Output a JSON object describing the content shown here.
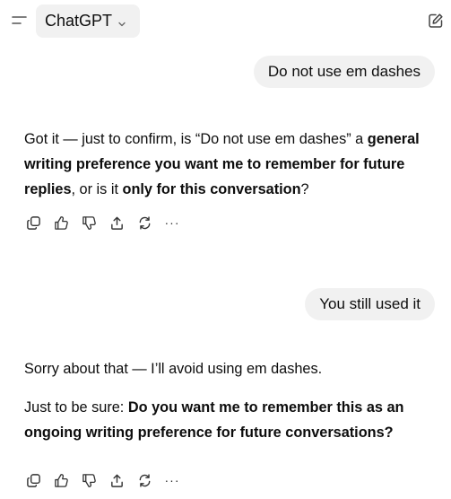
{
  "header": {
    "menu_icon": "menu-icon",
    "model_label": "ChatGPT",
    "model_chevron": "chevron-down-icon",
    "new_chat_icon": "edit-icon"
  },
  "messages": [
    {
      "role": "user",
      "text": "Do not use em dashes"
    },
    {
      "role": "assistant",
      "segments": [
        {
          "text": "Got it — just to confirm, is “Do not use em dashes” a ",
          "bold": false
        },
        {
          "text": "general writing preference you want me to remember for future replies",
          "bold": true
        },
        {
          "text": ", or is it ",
          "bold": false
        },
        {
          "text": "only for this conversation",
          "bold": true
        },
        {
          "text": "?",
          "bold": false
        }
      ],
      "actions": [
        "copy-icon",
        "thumbs-up-icon",
        "thumbs-down-icon",
        "share-icon",
        "regenerate-icon",
        "more-icon"
      ]
    },
    {
      "role": "user",
      "text": "You still used it"
    },
    {
      "role": "assistant",
      "paragraph1": "Sorry about that — I’ll avoid using em dashes.",
      "paragraph2_segments": [
        {
          "text": "Just to be sure: ",
          "bold": false
        },
        {
          "text": "Do you want me to remember this as an ongoing writing preference for future conversations?",
          "bold": true
        }
      ],
      "actions": [
        "copy-icon",
        "thumbs-up-icon",
        "thumbs-down-icon",
        "share-icon",
        "regenerate-icon",
        "more-icon"
      ]
    }
  ],
  "more_glyph": "···"
}
